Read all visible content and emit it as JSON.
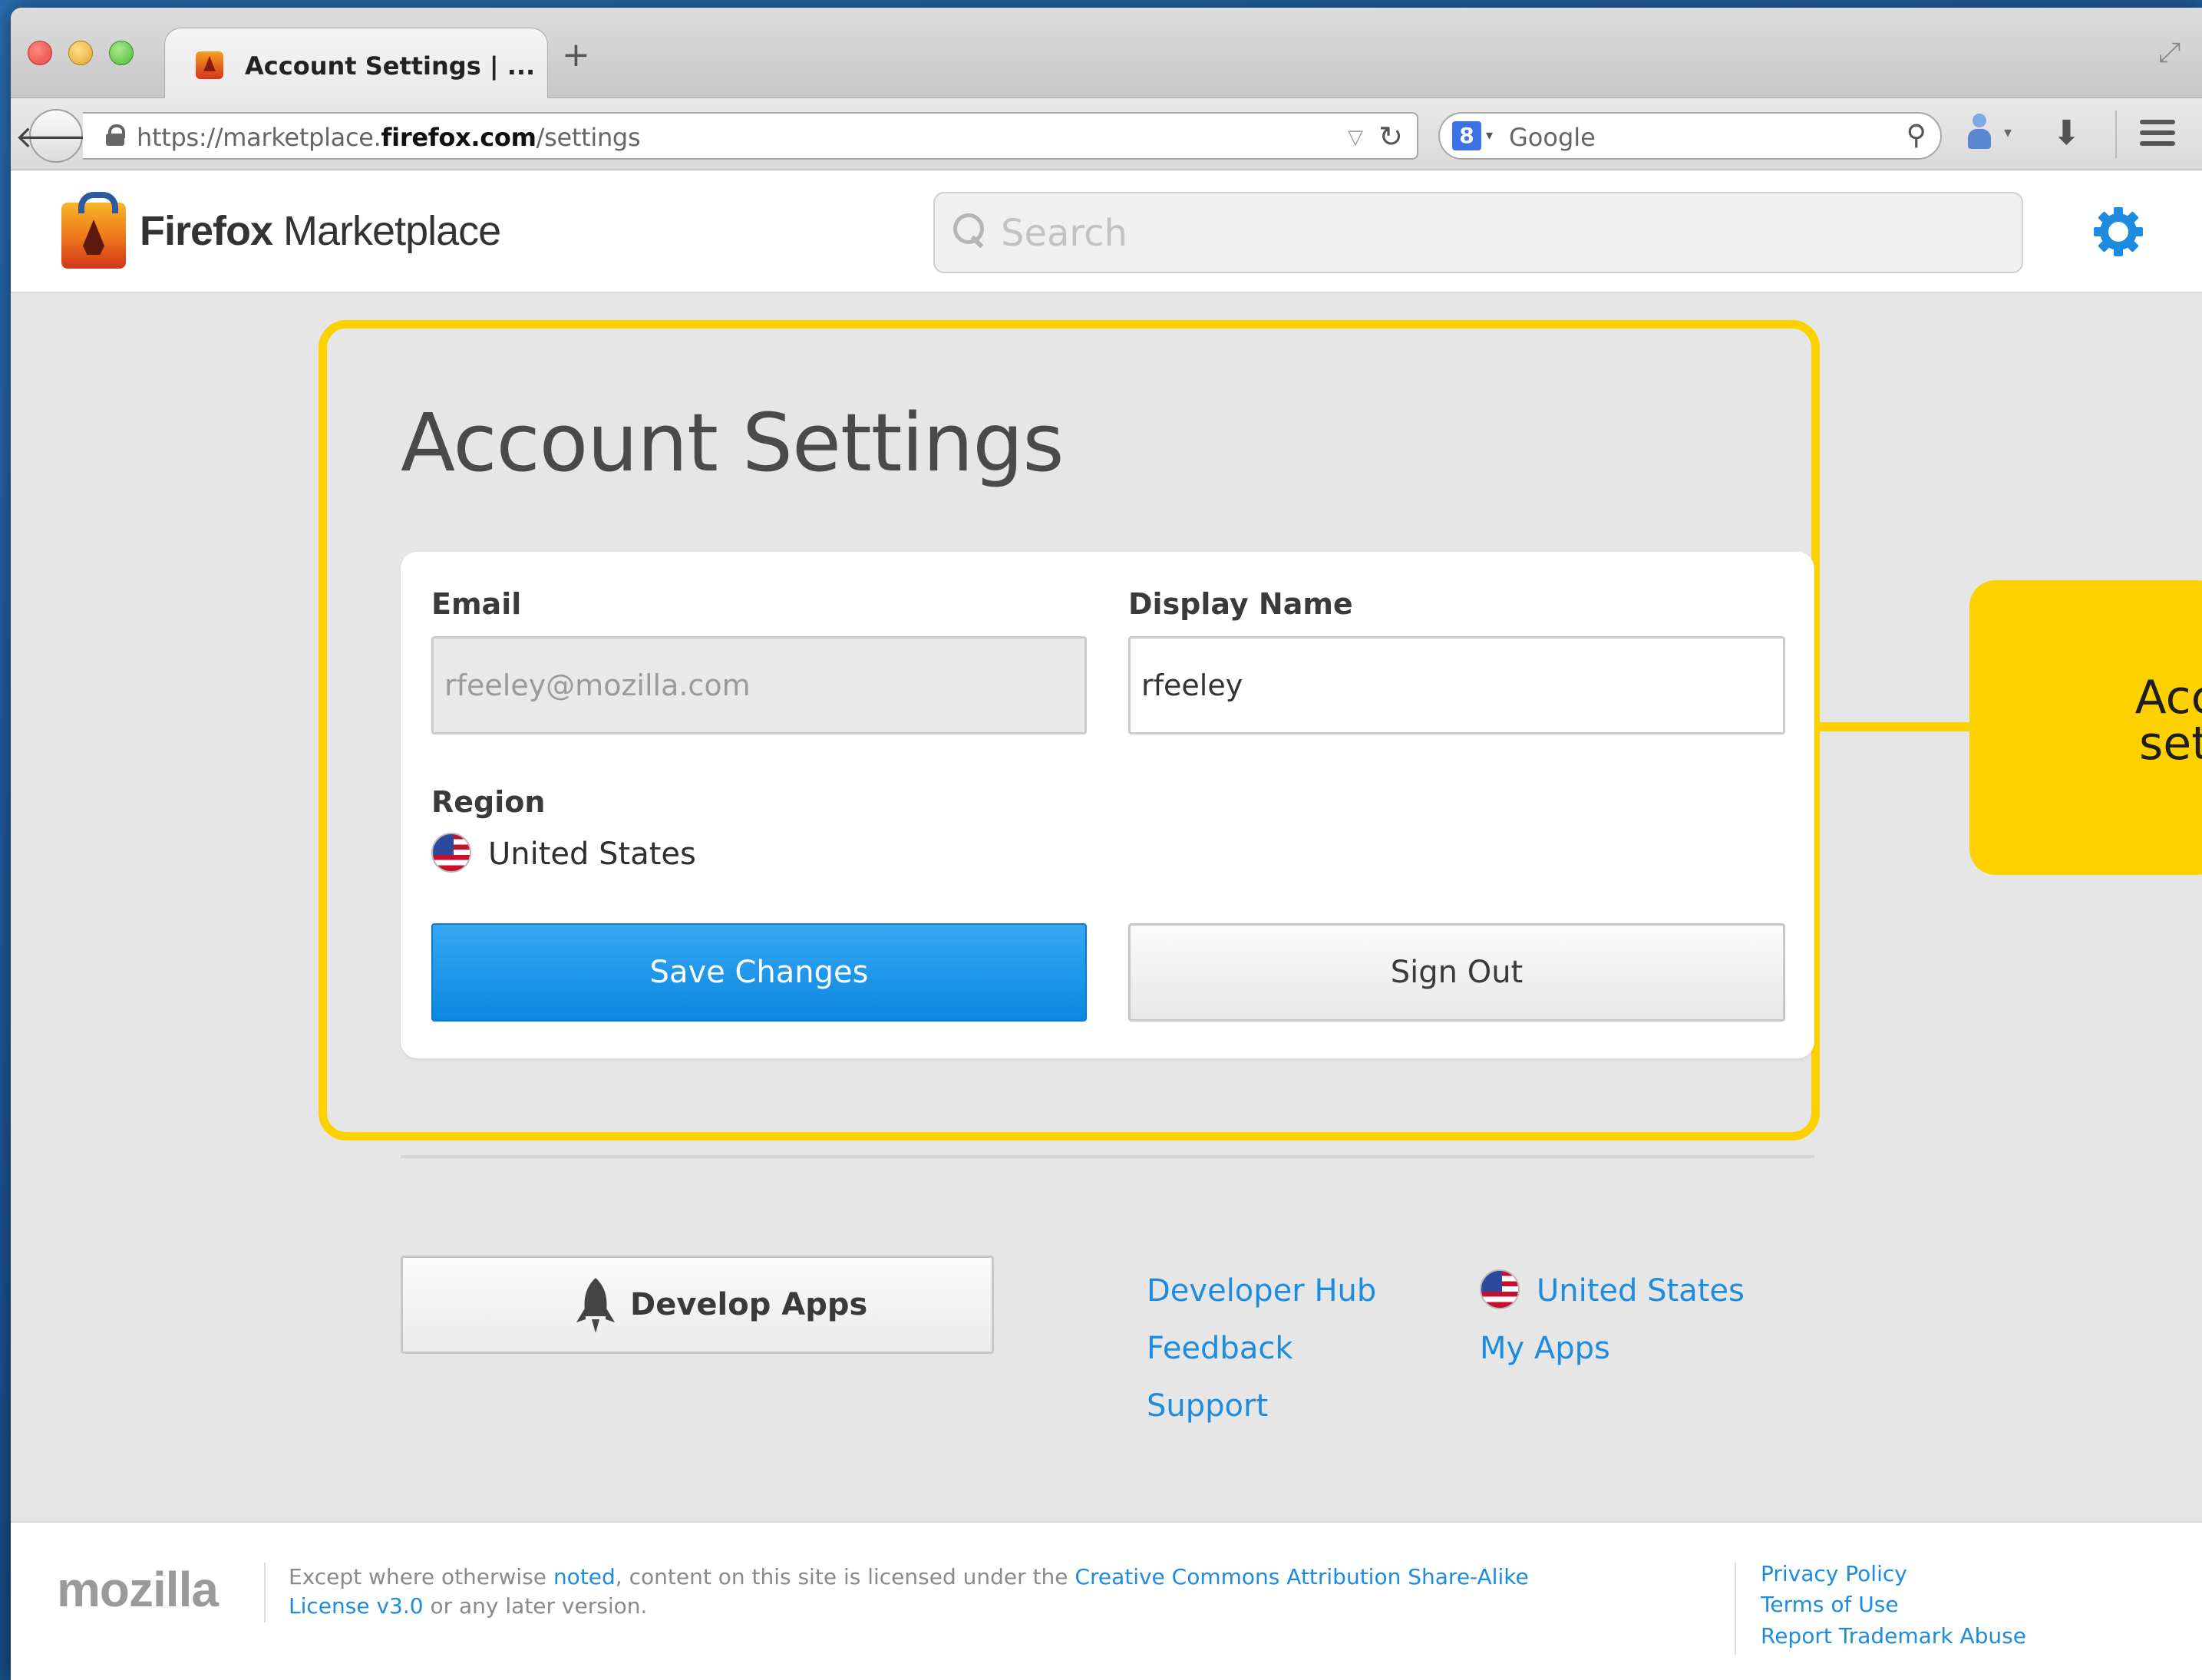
{
  "browser": {
    "tab_title": "Account Settings | ...",
    "new_tab_label": "+",
    "url_prefix": "https://marketplace.",
    "url_domain": "firefox.com",
    "url_path": "/settings",
    "search_engine": "Google",
    "search_engine_badge": "8"
  },
  "header": {
    "logo_bold": "Firefox",
    "logo_rest": " Marketplace",
    "search_placeholder": "Search"
  },
  "settings": {
    "title": "Account Settings",
    "email_label": "Email",
    "email_value": "rfeeley@mozilla.com",
    "display_name_label": "Display Name",
    "display_name_value": "rfeeley",
    "region_label": "Region",
    "region_value": "United States",
    "save_label": "Save Changes",
    "signout_label": "Sign Out"
  },
  "callout": {
    "text": "Accou\nsettin"
  },
  "links": {
    "develop_label": "Develop Apps",
    "developer_hub": "Developer Hub",
    "feedback": "Feedback",
    "support": "Support",
    "region": "United States",
    "my_apps": "My Apps"
  },
  "footer": {
    "mozilla": "mozilla",
    "license_1": "Except where otherwise ",
    "license_noted": "noted",
    "license_2": ", content on this site is licensed under the ",
    "license_cc": "Creative Commons Attribution Share-Alike License v3.0",
    "license_3": " or any later version.",
    "privacy": "Privacy Policy",
    "terms": "Terms of Use",
    "trademark": "Report Trademark Abuse"
  },
  "colors": {
    "accent_blue": "#0a88e0",
    "link_blue": "#1d8ce0",
    "highlight_yellow": "#fdd100"
  }
}
